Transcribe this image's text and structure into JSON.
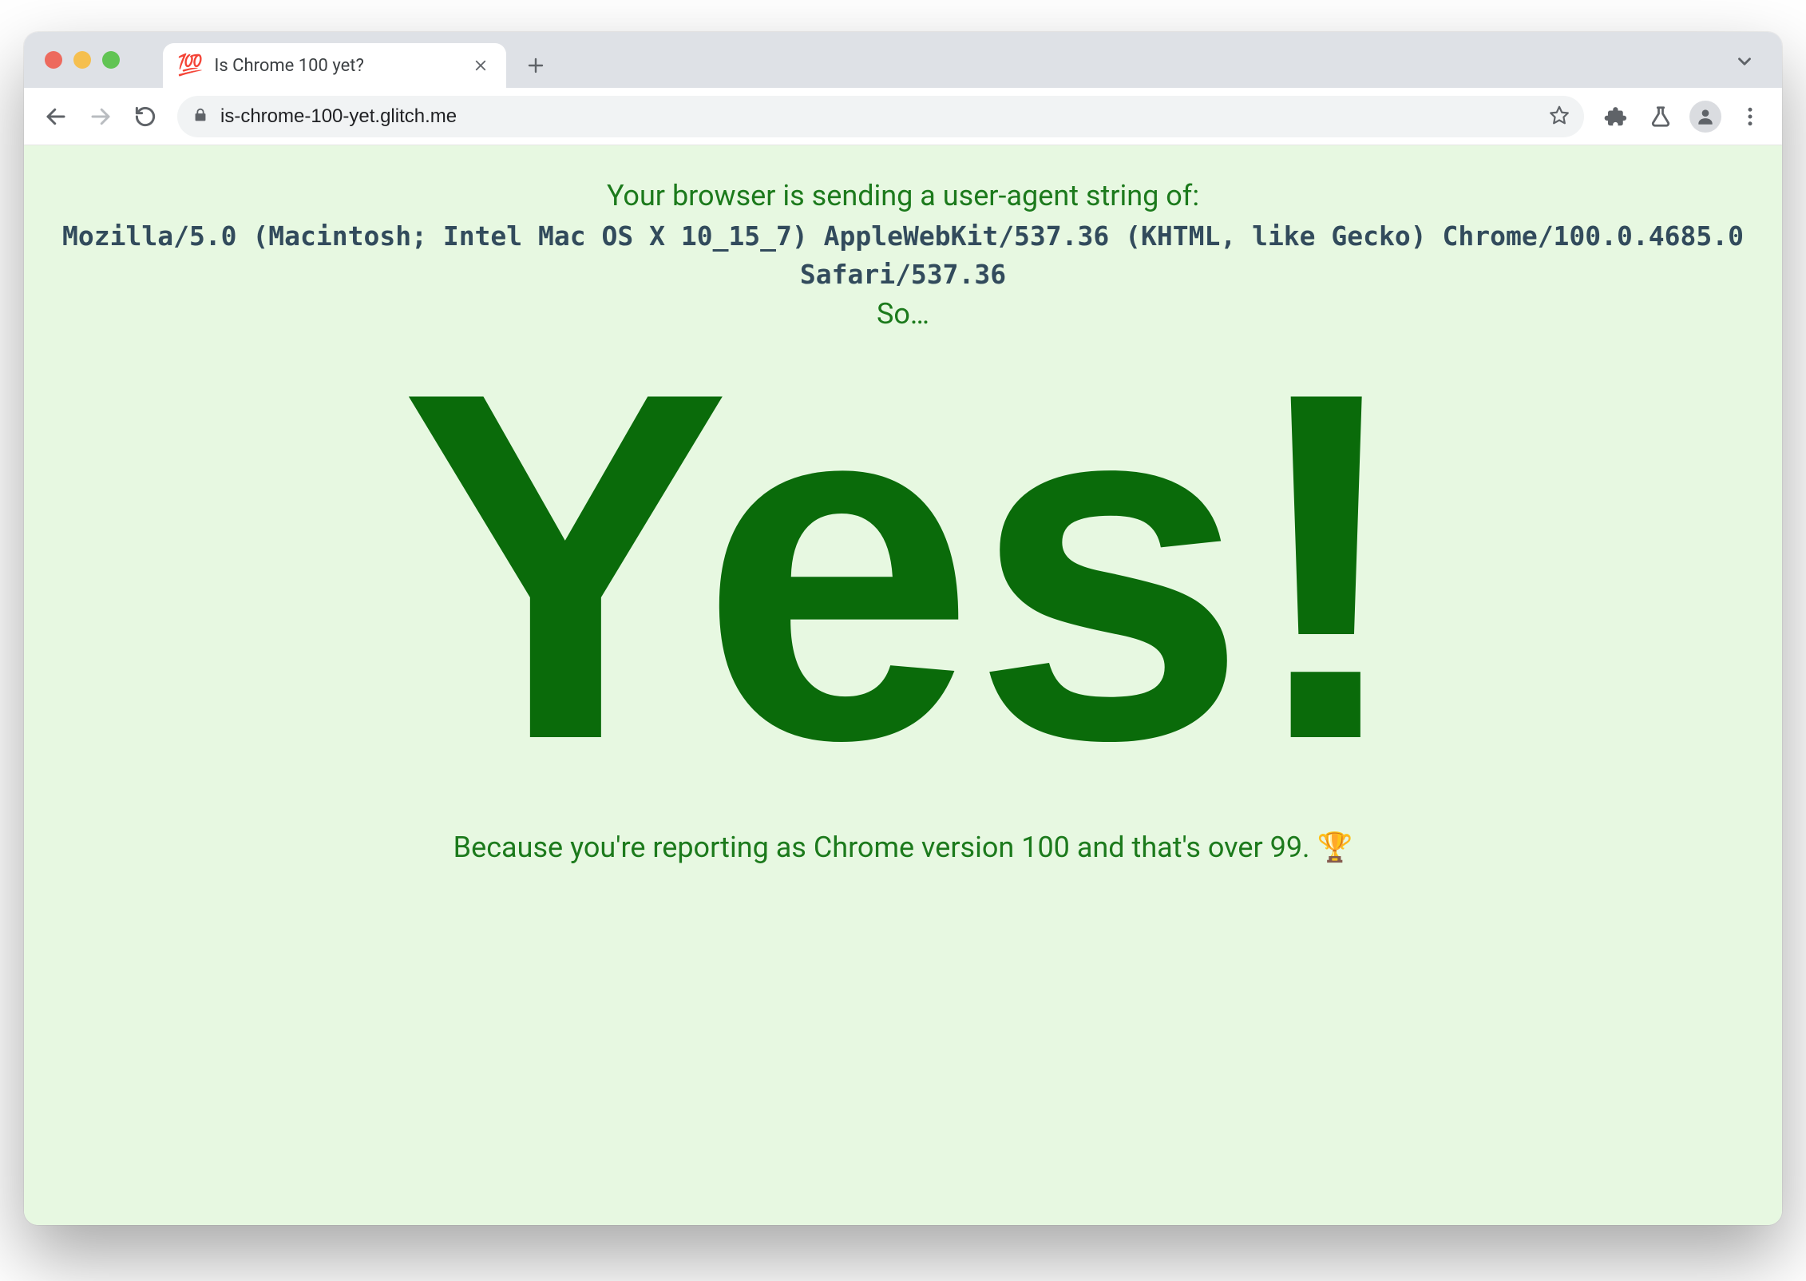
{
  "browser": {
    "tab": {
      "favicon": "💯",
      "title": "Is Chrome 100 yet?"
    },
    "url": "is-chrome-100-yet.glitch.me"
  },
  "page": {
    "intro": "Your browser is sending a user-agent string of:",
    "user_agent": "Mozilla/5.0 (Macintosh; Intel Mac OS X 10_15_7) AppleWebKit/537.36 (KHTML, like Gecko) Chrome/100.0.4685.0 Safari/537.36",
    "so": "So…",
    "headline": "Yes!",
    "because": "Because you're reporting as Chrome version 100 and that's over 99. 🏆"
  }
}
